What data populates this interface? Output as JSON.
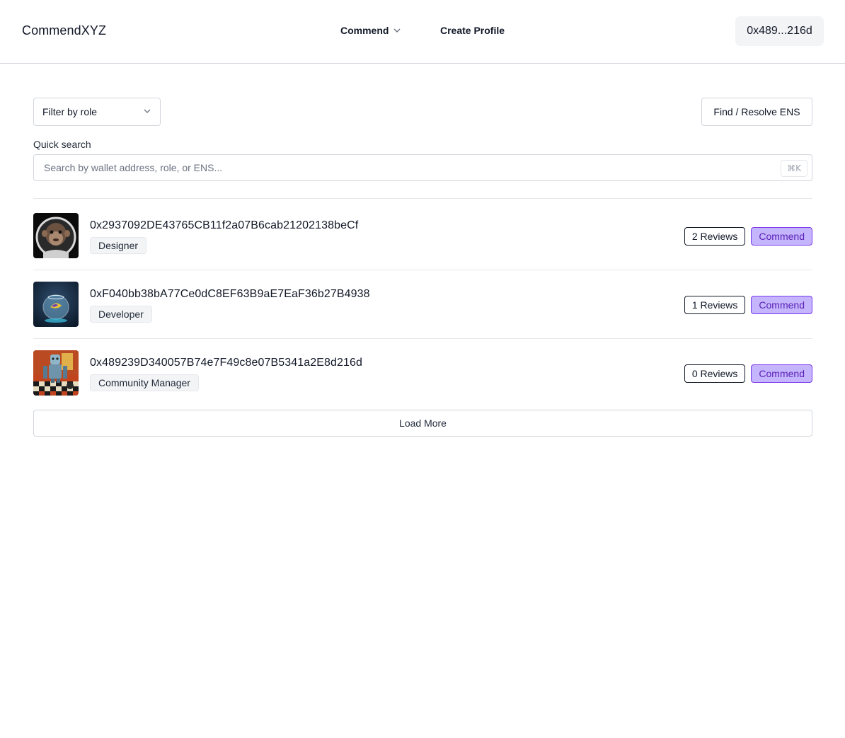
{
  "header": {
    "brand": "CommendXYZ",
    "nav_commend": "Commend",
    "nav_create_profile": "Create Profile",
    "wallet": "0x489...216d"
  },
  "filters": {
    "role_filter": "Filter by role",
    "ens_button": "Find / Resolve ENS",
    "quick_search_label": "Quick search",
    "search_placeholder": "Search by wallet address, role, or ENS...",
    "shortcut": "⌘K"
  },
  "profiles": [
    {
      "address": "0x2937092DE43765CB11f2a07B6cab21202138beCf",
      "role": "Designer",
      "reviews": "2 Reviews",
      "commend": "Commend",
      "avatar": "astronaut-monkey"
    },
    {
      "address": "0xF040bb38bA77Ce0dC8EF63B9aE7EaF36b27B4938",
      "role": "Developer",
      "reviews": "1 Reviews",
      "commend": "Commend",
      "avatar": "fishbowl"
    },
    {
      "address": "0x489239D340057B74e7F49c8e07B5341a2E8d216d",
      "role": "Community Manager",
      "reviews": "0 Reviews",
      "commend": "Commend",
      "avatar": "robot-chess"
    }
  ],
  "load_more": "Load More",
  "colors": {
    "commend_bg": "#c4b5fd",
    "commend_text": "#5b21b6",
    "border": "#d1d5db"
  }
}
